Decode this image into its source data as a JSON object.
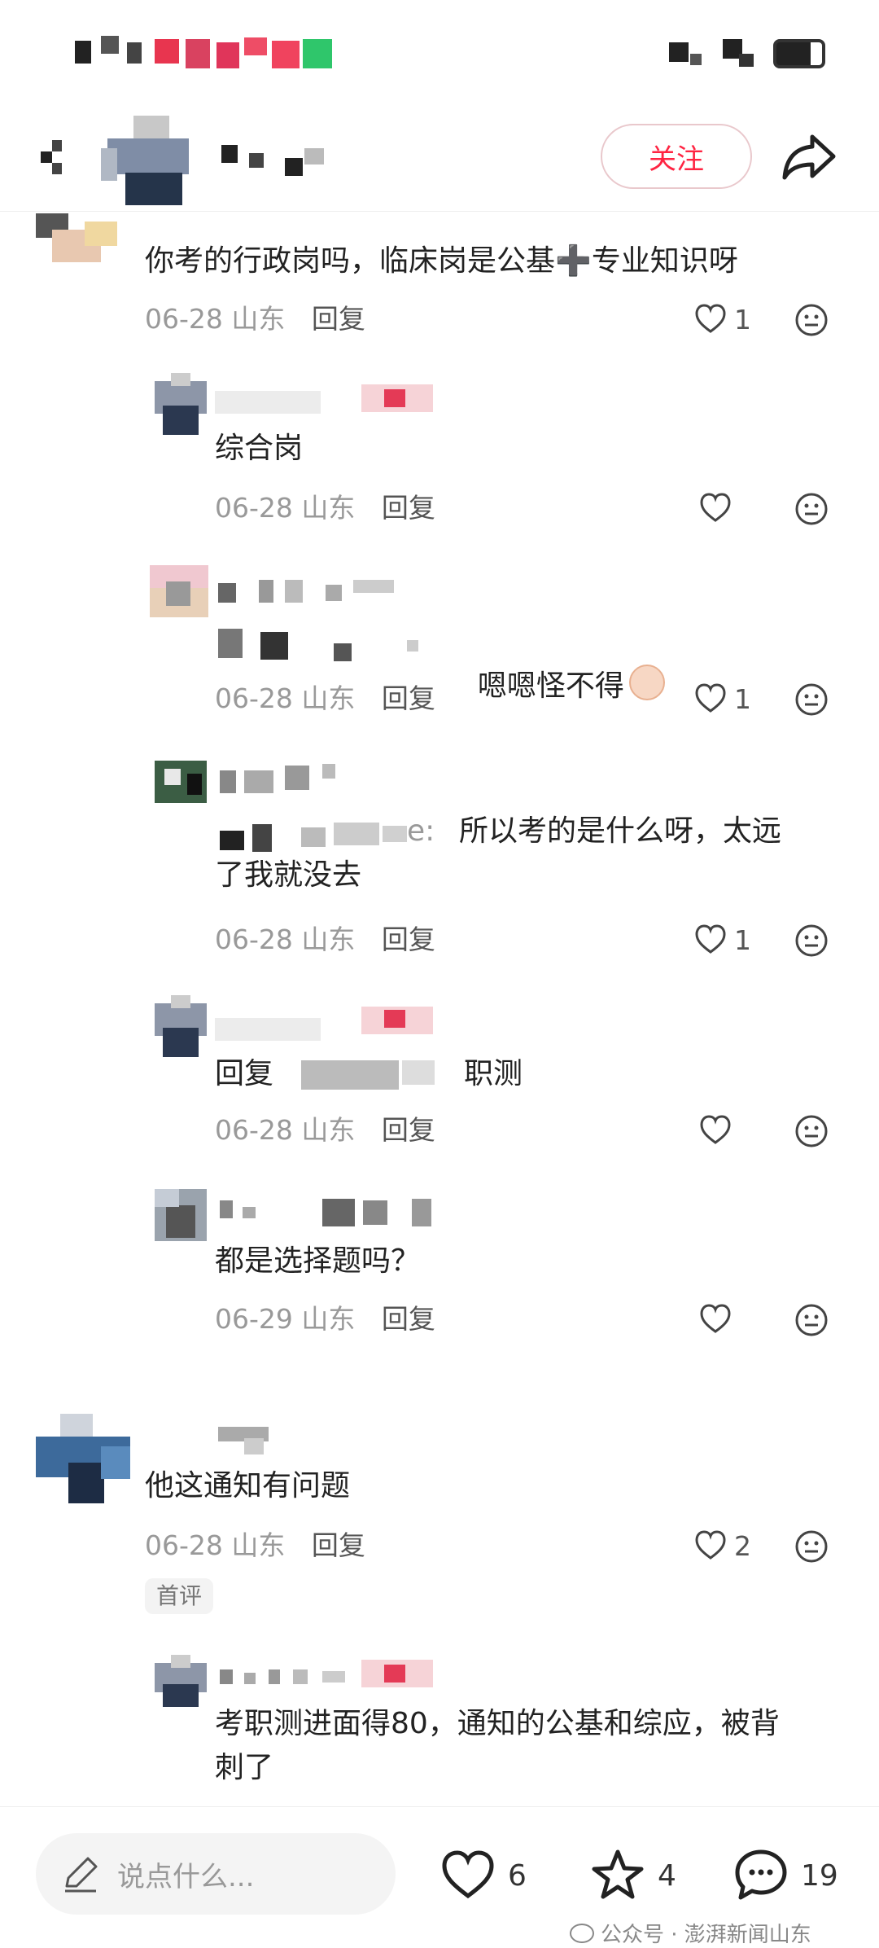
{
  "header": {
    "follow_label": "关注"
  },
  "comments": [
    {
      "text": "你考的行政岗吗，临床岗是公基➕专业知识呀",
      "date": "06-28",
      "region": "山东",
      "reply": "回复",
      "likes": "1"
    },
    {
      "text": "综合岗",
      "date": "06-28",
      "region": "山东",
      "reply": "回复",
      "likes": ""
    },
    {
      "text": "嗯嗯怪不得",
      "date": "06-28",
      "region": "山东",
      "reply": "回复",
      "likes": "1"
    },
    {
      "text_prefix": "e:",
      "text": "所以考的是什么呀，太远\n了我就没去",
      "date": "06-28",
      "region": "山东",
      "reply": "回复",
      "likes": "1"
    },
    {
      "text_a": "回复",
      "text_b": "职测",
      "date": "06-28",
      "region": "山东",
      "reply": "回复",
      "likes": ""
    },
    {
      "text": "都是选择题吗？",
      "date": "06-29",
      "region": "山东",
      "reply": "回复",
      "likes": ""
    },
    {
      "text": "他这通知有问题",
      "date": "06-28",
      "region": "山东",
      "reply": "回复",
      "likes": "2",
      "badge": "首评"
    },
    {
      "text": "考职测进面得80，通知的公基和综应，被背\n刺了"
    }
  ],
  "bottom": {
    "placeholder": "说点什么...",
    "likes": "6",
    "stars": "4",
    "comments": "19"
  },
  "watermark": "公众号 · 澎湃新闻山东",
  "colors": {
    "accent": "#ff2442"
  }
}
